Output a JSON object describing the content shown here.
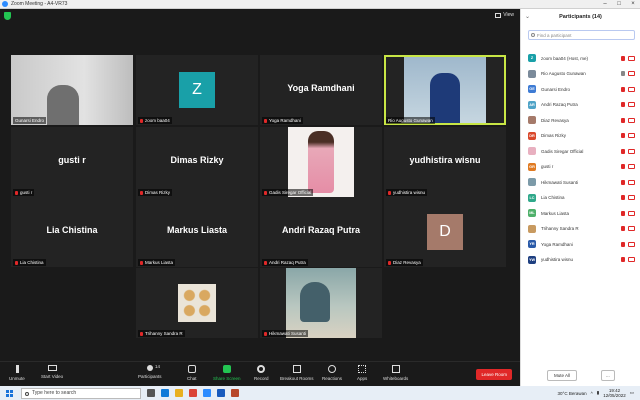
{
  "window": {
    "title": "Zoom Meeting - A4-VR73"
  },
  "view": {
    "label": "View"
  },
  "tiles": [
    {
      "name": "Gunarsi Endro",
      "big": "",
      "avatar": "",
      "avatar_color": "",
      "type": "video"
    },
    {
      "name": "zoom baa04",
      "big": "",
      "avatar": "Z",
      "avatar_color": "#19a0a8",
      "type": "avatar"
    },
    {
      "name": "Yoga Ramdhani",
      "big": "Yoga Ramdhani",
      "avatar": "",
      "avatar_color": "",
      "type": "name"
    },
    {
      "name": "Rio Augusto Gunawan",
      "big": "",
      "avatar": "",
      "avatar_color": "",
      "type": "video"
    },
    {
      "name": "gusti r",
      "big": "gusti r",
      "avatar": "",
      "avatar_color": "",
      "type": "name"
    },
    {
      "name": "Dimas Rizky",
      "big": "Dimas Rizky",
      "avatar": "",
      "avatar_color": "",
      "type": "name"
    },
    {
      "name": "Gadis Siregar Official",
      "big": "",
      "avatar": "",
      "avatar_color": "",
      "type": "photo"
    },
    {
      "name": "yudhistira wisnu",
      "big": "yudhistira wisnu",
      "avatar": "",
      "avatar_color": "",
      "type": "name"
    },
    {
      "name": "Lia Chistina",
      "big": "Lia Chistina",
      "avatar": "",
      "avatar_color": "",
      "type": "name"
    },
    {
      "name": "Markus Liasta",
      "big": "Markus Liasta",
      "avatar": "",
      "avatar_color": "",
      "type": "name"
    },
    {
      "name": "Andri Razaq Putra",
      "big": "Andri Razaq Putra",
      "avatar": "",
      "avatar_color": "",
      "type": "name"
    },
    {
      "name": "Diaz Revasya",
      "big": "",
      "avatar": "D",
      "avatar_color": "#a57a6a",
      "type": "avatar"
    },
    {
      "name": "Trihanny Sandra R",
      "big": "",
      "avatar": "",
      "avatar_color": "",
      "type": "photo"
    },
    {
      "name": "Hikmawati Susanti",
      "big": "",
      "avatar": "",
      "avatar_color": "",
      "type": "photo"
    }
  ],
  "toolbar": {
    "unmute": "Unmute",
    "start_video": "Start Video",
    "participants": "Participants",
    "participants_count": "14",
    "chat": "Chat",
    "share_screen": "Share Screen",
    "record": "Record",
    "breakout_rooms": "Breakout Rooms",
    "reactions": "Reactions",
    "apps": "Apps",
    "whiteboards": "Whiteboards",
    "leave": "Leave Room"
  },
  "panel": {
    "title": "Participants (14)",
    "search_placeholder": "Find a participant",
    "mute_all": "Mute All",
    "more": "...",
    "participants": [
      {
        "initials": "Z",
        "name": "zoom baa04 (Host, me)",
        "color": "#19a0a8",
        "mic": "off"
      },
      {
        "initials": "",
        "name": "Rio Augusto Gunawan",
        "color": "#7a8a9a",
        "mic": "on"
      },
      {
        "initials": "GE",
        "name": "Gunarsi Endro",
        "color": "#3d7bd4",
        "mic": "off"
      },
      {
        "initials": "AR",
        "name": "Andri Razaq Putra",
        "color": "#4fa3c7",
        "mic": "off"
      },
      {
        "initials": "",
        "name": "Diaz Revasya",
        "color": "#a57a6a",
        "mic": "off"
      },
      {
        "initials": "DR",
        "name": "Dimas Rizky",
        "color": "#d9482b",
        "mic": "off"
      },
      {
        "initials": "",
        "name": "Gadis Siregar Official",
        "color": "#e8b0c0",
        "mic": "off"
      },
      {
        "initials": "GR",
        "name": "gusti r",
        "color": "#e07a22",
        "mic": "off"
      },
      {
        "initials": "",
        "name": "Hikmawati Susanti",
        "color": "#7c9aa8",
        "mic": "off"
      },
      {
        "initials": "LC",
        "name": "Lia Chistina",
        "color": "#2fa88a",
        "mic": "off"
      },
      {
        "initials": "ML",
        "name": "Markus Liasta",
        "color": "#4fb06a",
        "mic": "off"
      },
      {
        "initials": "",
        "name": "Trihanny Sandra R",
        "color": "#c89a60",
        "mic": "off"
      },
      {
        "initials": "YR",
        "name": "Yoga Ramdhani",
        "color": "#2a5aa8",
        "mic": "off"
      },
      {
        "initials": "YW",
        "name": "yudhistira wisnu",
        "color": "#1e3f80",
        "mic": "off"
      }
    ]
  },
  "taskbar": {
    "search": "Type here to search",
    "weather": "30°C  Berawan",
    "time": "19:42",
    "date": "12/05/2022"
  }
}
